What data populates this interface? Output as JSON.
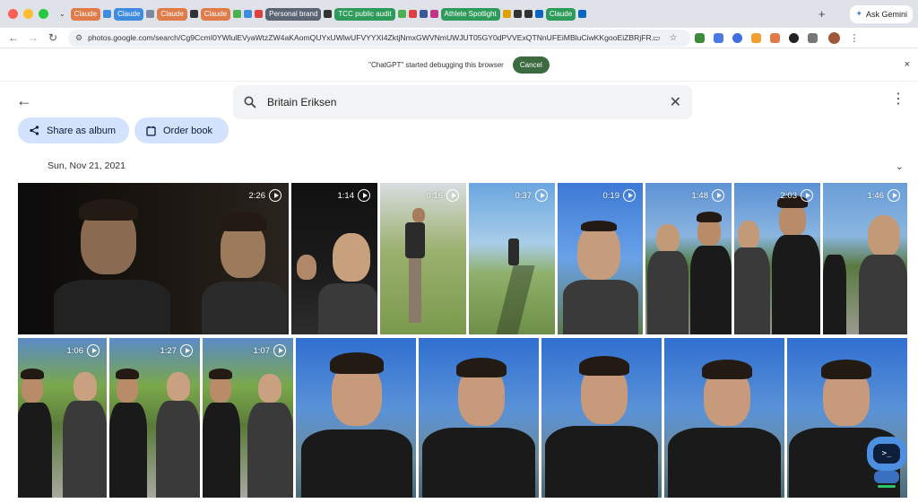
{
  "browser": {
    "tabs": [
      {
        "label": "Claude",
        "color": "#e07b4a"
      },
      {
        "label": "Claude",
        "color": "#3f8be0"
      },
      {
        "label": "Claude",
        "color": "#e07b4a"
      },
      {
        "label": "Claude",
        "color": "#e07b4a"
      },
      {
        "label": "Personal brand",
        "color": "#5a6472"
      },
      {
        "label": "TCC public audit",
        "color": "#2e9b5b"
      },
      {
        "label": "Athlete Spotlight",
        "color": "#2e9b5b"
      },
      {
        "label": "Claude",
        "color": "#2e9b5b"
      }
    ],
    "gemini_label": "Ask Gemini",
    "new_tab": "+",
    "url": "photos.google.com/search/Cg9CcmI0YWlulEVyaWtzZW4aKAomQUYxUWlwUFVYYXI4ZktjNmxGWVNmUWJUT05GY0dPVVExQTNnUFEiMBluCiwKKgooEiZBRjFR..."
  },
  "debug_bar": {
    "message": "\"ChatGPT\" started debugging this browser",
    "cancel_label": "Cancel",
    "close_icon": "×"
  },
  "app": {
    "search_query": "Britain Eriksen",
    "share_label": "Share as album",
    "order_label": "Order book",
    "date": "Sun, Nov 21, 2021"
  },
  "photos": {
    "durations": [
      "2:26",
      "1:14",
      "0:16",
      "0:37",
      "0:19",
      "1:48",
      "2:03",
      "1:46",
      "1:06",
      "1:27",
      "1:07"
    ]
  },
  "assistant": {
    "screen_text": ">_"
  }
}
